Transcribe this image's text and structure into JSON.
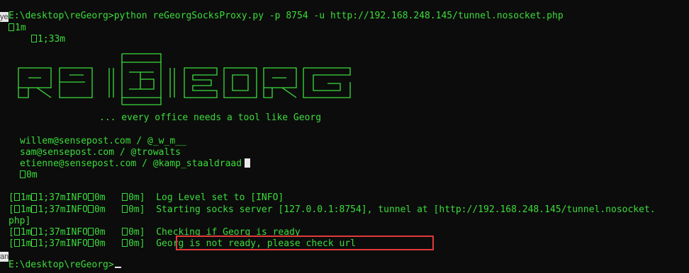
{
  "edge_fragments": {
    "left_top": "ye",
    "left_mid": "an"
  },
  "terminal": {
    "command_line": "E:\\desktop\\reGeorg>python reGeorgSocksProxy.py -p 8754 -u http://192.168.248.145/tunnel.nosocket.php",
    "escape_1": "1m",
    "escape_2": "1;33m",
    "tagline": "... every office needs a tool like Georg",
    "authors": [
      "willem@sensepost.com / @_w_m__",
      "sam@sensepost.com / @trowalts",
      "etienne@sensepost.com / @kamp_staaldraad"
    ],
    "reset_code": "0m",
    "log_lines": [
      {
        "prefix_open": "[",
        "code_a": "1m",
        "code_b": "1;37mINFO",
        "code_c": "0m",
        "code_d": "0m]",
        "message": "Log Level set to [INFO]"
      },
      {
        "prefix_open": "[",
        "code_a": "1m",
        "code_b": "1;37mINFO",
        "code_c": "0m",
        "code_d": "0m]",
        "message": "Starting socks server [127.0.0.1:8754], tunnel at [http://192.168.248.145/tunnel.nosocket."
      },
      {
        "prefix_open": "[",
        "code_a": "1m",
        "code_b": "1;37mINFO",
        "code_c": "0m",
        "code_d": "0m]",
        "message": "Checking if Georg is ready"
      },
      {
        "prefix_open": "[",
        "code_a": "1m",
        "code_b": "1;37mINFO",
        "code_c": "0m",
        "code_d": "0m]",
        "message": "Georg is not ready, please check url"
      }
    ],
    "wrap_continuation": "php]",
    "final_prompt": "E:\\desktop\\reGeorg>"
  },
  "colors": {
    "background": "#0c0c0c",
    "text": "#3bdc3b",
    "highlight": "#e23a3a"
  }
}
